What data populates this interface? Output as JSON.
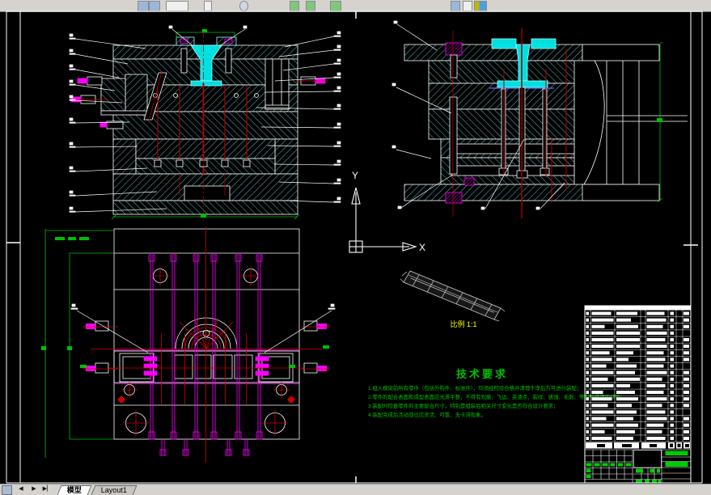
{
  "app": {
    "toolbar": {
      "icons": [
        "new-file-icon",
        "open-file-icon",
        "preview-icon",
        "print-icon",
        "redraw-icon",
        "pan-icon",
        "zoom-icon",
        "properties-icon",
        "layer-icon",
        "osnap-icon",
        "help-icon"
      ],
      "background": "#d6d3ce"
    },
    "statusbar": {
      "background": "#d6d3ce",
      "nav_prev": "◀",
      "nav_next": "▶",
      "nav_last": "▶▏",
      "tabs": [
        {
          "label": "模型",
          "active": true
        },
        {
          "label": "Layout1",
          "active": false
        }
      ]
    }
  },
  "drawing": {
    "ucs": {
      "x": "X",
      "y": "Y"
    },
    "part_scale_label": "比例 1:1",
    "tech_requirements": {
      "title": "技术要求",
      "items": [
        "1.组入模架前所有零件（包括外购件、标准件），均须经检验合格并清理干净后方可进行装配；",
        "2.零件的配合表面和成型表面应光滑平整，不得有划痕、飞边、夹渣点、裂纹、锈蚀、毛刺、等影响使用的缺陷；",
        "3.装配时检查零件的主要配合尺寸，特别是组装后相关尺寸变化是否符合设计要求；",
        "4.装配完成后活动部位应灵活、可靠、无卡滞现象。"
      ]
    },
    "colors": {
      "outline": "#ffffff",
      "hatch": "#5fd3d3",
      "sprue": "#00e0e0",
      "dimension_green": "#00bf00",
      "centerline_red": "#cc0000",
      "detail_magenta": "#ff00ff",
      "scale_text_yellow": "#ffff00",
      "tech_text_green": "#00bf00"
    },
    "titleblock": {
      "bom": {
        "rows": [
          [
            24,
            26,
            22,
            7
          ],
          [
            27,
            18,
            24,
            7
          ],
          [
            16,
            27,
            20,
            7
          ],
          [
            27,
            29,
            25,
            0
          ],
          [
            27,
            29,
            23,
            7
          ],
          [
            27,
            29,
            25,
            7
          ],
          [
            22,
            21,
            21,
            7
          ],
          [
            25,
            15,
            23,
            7
          ],
          [
            18,
            25,
            21,
            0
          ],
          [
            27,
            23,
            25,
            7
          ],
          [
            20,
            29,
            19,
            7
          ],
          [
            27,
            17,
            23,
            7
          ],
          [
            14,
            23,
            21,
            7
          ],
          [
            25,
            27,
            25,
            7
          ],
          [
            20,
            19,
            19,
            7
          ],
          [
            27,
            25,
            23,
            0
          ],
          [
            18,
            21,
            25,
            7
          ],
          [
            27,
            27,
            21,
            7
          ],
          [
            16,
            23,
            19,
            7
          ],
          [
            25,
            21,
            23,
            7
          ]
        ]
      }
    }
  }
}
